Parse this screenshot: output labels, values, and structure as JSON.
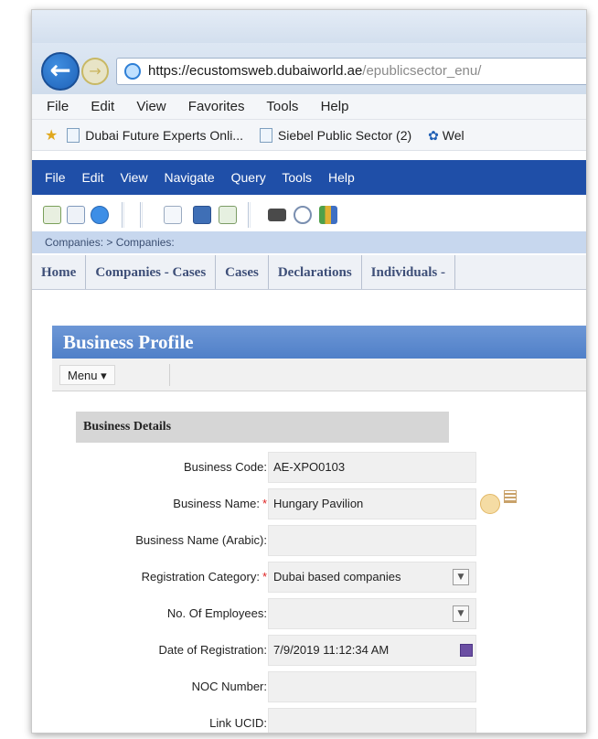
{
  "browser": {
    "address": {
      "host": "https://ecustomsweb.dubaiworld.ae",
      "path": "/epublicsector_enu/"
    },
    "menu": [
      "File",
      "Edit",
      "View",
      "Favorites",
      "Tools",
      "Help"
    ],
    "favorites": [
      "Dubai Future Experts Onli...",
      "Siebel Public Sector (2)",
      "Wel"
    ]
  },
  "app": {
    "menu": [
      "File",
      "Edit",
      "View",
      "Navigate",
      "Query",
      "Tools",
      "Help"
    ],
    "breadcrumb": "Companies:  > Companies:",
    "tabs": [
      "Home",
      "Companies - Cases",
      "Cases",
      "Declarations",
      "Individuals -"
    ]
  },
  "applet": {
    "title": "Business Profile",
    "menu_label": "Menu ▾",
    "section_title": "Business Details",
    "fields": [
      {
        "label": "Business Code:",
        "value": "AE-XPO0103",
        "required": false
      },
      {
        "label": "Business Name:",
        "value": "Hungary Pavilion",
        "required": true
      },
      {
        "label": "Business Name (Arabic):",
        "value": "",
        "required": false
      },
      {
        "label": "Registration Category:",
        "value": "Dubai based companies",
        "required": true
      },
      {
        "label": "No. Of Employees:",
        "value": "",
        "required": false
      },
      {
        "label": "Date of Registration:",
        "value": "7/9/2019 11:12:34 AM",
        "required": false
      },
      {
        "label": "NOC Number:",
        "value": "",
        "required": false
      },
      {
        "label": "Link UCID:",
        "value": "",
        "required": false
      }
    ],
    "required_marker": "*"
  },
  "icons": {
    "back": "back-arrow-icon",
    "forward": "forward-arrow-icon",
    "site": "ie-logo-icon",
    "favorites": "favorites-star-icon"
  },
  "colors": {
    "app_menubar": "#1f4fa8",
    "applet_header": "#5a87cd",
    "breadcrumb_bg": "#c7d7ee",
    "required": "#dd2222"
  }
}
